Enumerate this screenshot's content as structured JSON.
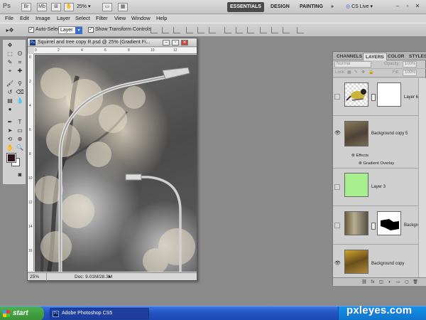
{
  "appbar": {
    "logo": "Ps",
    "zoom": "25%",
    "workspaces": [
      "ESSENTIALS",
      "DESIGN",
      "PAINTING"
    ],
    "more": "»",
    "cs_live": "CS Live"
  },
  "menu": [
    "File",
    "Edit",
    "Image",
    "Layer",
    "Select",
    "Filter",
    "View",
    "Window",
    "Help"
  ],
  "options": {
    "auto_select_label": "Auto-Select:",
    "auto_select_value": "Layer",
    "show_transform_label": "Show Transform Controls"
  },
  "document": {
    "title": "Squirrel and tree copy R.psd @ 25% (Gradient Fi...",
    "zoom": "25%",
    "doc_info": "Doc: 9.01M/28.3M",
    "ruler_top": [
      "0",
      "2",
      "4",
      "6",
      "8",
      "10",
      "12"
    ],
    "ruler_left": [
      "0",
      "2",
      "4",
      "6",
      "8",
      "10",
      "12",
      "14",
      "16"
    ]
  },
  "panel": {
    "tabs": [
      "CHANNELS",
      "LAYERS",
      "COLOR",
      "STYLES"
    ],
    "active_tab": "LAYERS",
    "blend_mode": "Normal",
    "opacity_label": "Opacity:",
    "opacity_value": "100%",
    "lock_label": "Lock:",
    "fill_label": "Fill:",
    "fill_value": "100%",
    "layers": [
      {
        "name": "Layer 6",
        "visible": false
      },
      {
        "name": "Background copy 5",
        "visible": true
      },
      {
        "name": "Layer 3",
        "visible": false
      },
      {
        "name": "Backgrou",
        "visible": false
      },
      {
        "name": "Background copy",
        "visible": true
      }
    ],
    "effects_label": "Effects",
    "effect_item": "Gradient Overlay"
  },
  "taskbar": {
    "start": "start",
    "task": "Adobe Photoshop CS5"
  },
  "watermark": "pxleyes.com"
}
